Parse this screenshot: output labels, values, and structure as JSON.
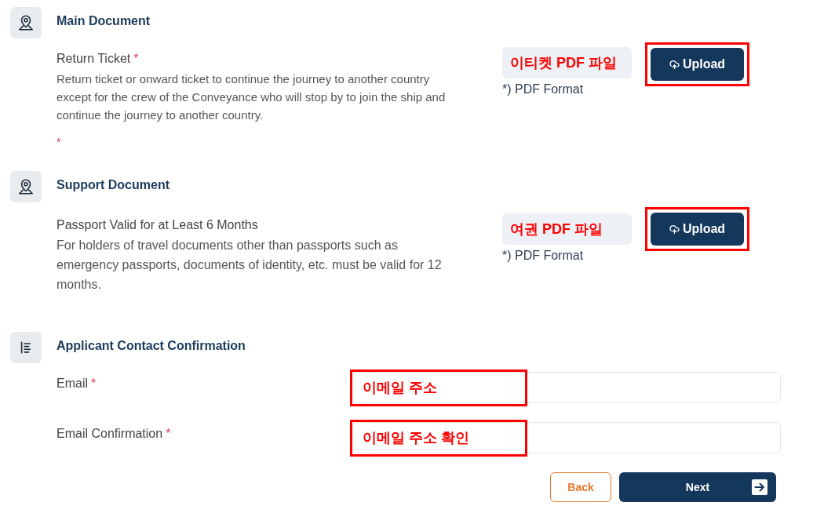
{
  "sections": [
    {
      "kind": "documents",
      "title": "Main Document",
      "documents": [
        {
          "label": "Return Ticket",
          "required_mark": "*",
          "description": "Return ticket or onward ticket to continue the journey to another country except for the crew of the Conveyance who will stop by to join the ship and continue the journey to another country.",
          "error_mark": "*",
          "file_field": "이티켓 PDF 파일",
          "format_note": "*) PDF Format",
          "upload_button": "Upload",
          "highlighted": true
        }
      ]
    },
    {
      "kind": "documents",
      "title": "Support Document",
      "documents": [
        {
          "label": "Passport Valid for at Least 6 Months",
          "description": "For holders of travel documents other than passports such as emergency passports, documents of identity, etc. must be valid for 12 months.",
          "file_field": "여권 PDF 파일",
          "format_note": "*) PDF Format",
          "upload_button": "Upload",
          "highlighted": true
        }
      ]
    },
    {
      "kind": "contact",
      "title": "Applicant Contact Confirmation",
      "fields": [
        {
          "label": "Email",
          "required_mark": "*",
          "annotation": "이메일 주소",
          "highlighted": true
        },
        {
          "label": "Email Confirmation",
          "required_mark": "*",
          "annotation": "이메일 주소 확인",
          "highlighted": true
        }
      ]
    }
  ],
  "actions": [
    {
      "kind": "back",
      "label": "Back"
    },
    {
      "kind": "next",
      "label": "Next"
    }
  ]
}
